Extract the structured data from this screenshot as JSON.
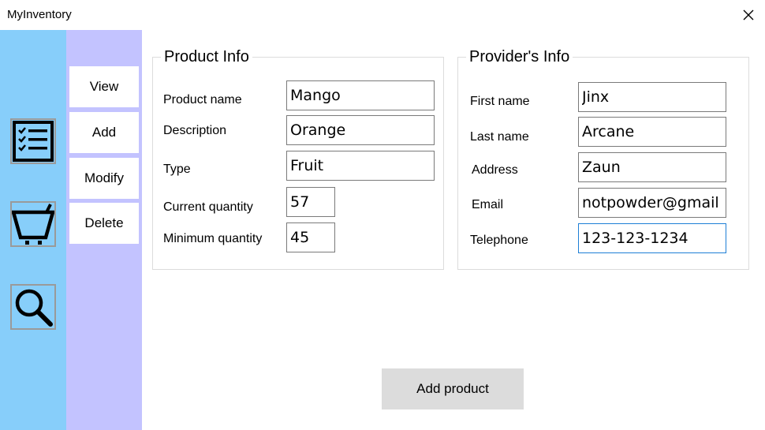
{
  "window": {
    "title": "MyInventory"
  },
  "menu": {
    "view": "View",
    "add": "Add",
    "modify": "Modify",
    "delete": "Delete"
  },
  "sidebar_icons": [
    "checklist-icon",
    "cart-icon",
    "search-icon"
  ],
  "product_info": {
    "title": "Product Info",
    "name_label": "Product name",
    "name_value": "Mango",
    "description_label": "Description",
    "description_value": "Orange",
    "type_label": "Type",
    "type_value": "Fruit",
    "current_qty_label": "Current quantity",
    "current_qty_value": "57",
    "min_qty_label": "Minimum quantity",
    "min_qty_value": "45"
  },
  "provider_info": {
    "title": "Provider's Info",
    "first_name_label": "First name",
    "first_name_value": "Jinx",
    "last_name_label": "Last name",
    "last_name_value": "Arcane",
    "address_label": "Address",
    "address_value": "Zaun",
    "email_label": "Email",
    "email_value": "notpowder@gmail",
    "telephone_label": "Telephone",
    "telephone_value": "123-123-1234"
  },
  "actions": {
    "add_product": "Add product"
  },
  "colors": {
    "left_bar": "#87cefa",
    "menu_bar": "#c3c3ff",
    "button_gray": "#dcdcdc",
    "focus_border": "#1e7fd6"
  }
}
